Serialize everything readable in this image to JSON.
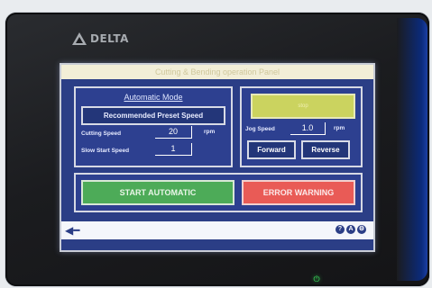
{
  "device": {
    "brand": "DELTA",
    "power_indicator": "power-icon"
  },
  "screen": {
    "title": "Cutting & Bending  operation Panel"
  },
  "automatic": {
    "title": "Automatic Mode",
    "preset_button": "Recommended Preset Speed",
    "cutting_speed_label": "Cutting Speed",
    "cutting_speed_value": "20",
    "cutting_speed_unit": "rpm",
    "slow_start_label": "Slow Start Speed",
    "slow_start_value": "1"
  },
  "jog": {
    "status_text": "stop",
    "jog_speed_label": "Jog Speed",
    "jog_speed_value": "1.0",
    "jog_speed_unit": "rpm",
    "forward_button": "Forward",
    "reverse_button": "Reverse"
  },
  "actions": {
    "start_button": "START AUTOMATIC",
    "error_button": "ERROR WARNING"
  },
  "footer": {
    "back_icon": "back-arrow-icon",
    "icons": [
      "help-icon",
      "user-icon",
      "settings-icon"
    ],
    "icon_glyphs": [
      "?",
      "A",
      "⚙"
    ]
  },
  "colors": {
    "screen_bg": "#2b3e86",
    "start_green": "#4dab58",
    "error_red": "#e95b56",
    "status_yellow": "#cbd35f"
  }
}
